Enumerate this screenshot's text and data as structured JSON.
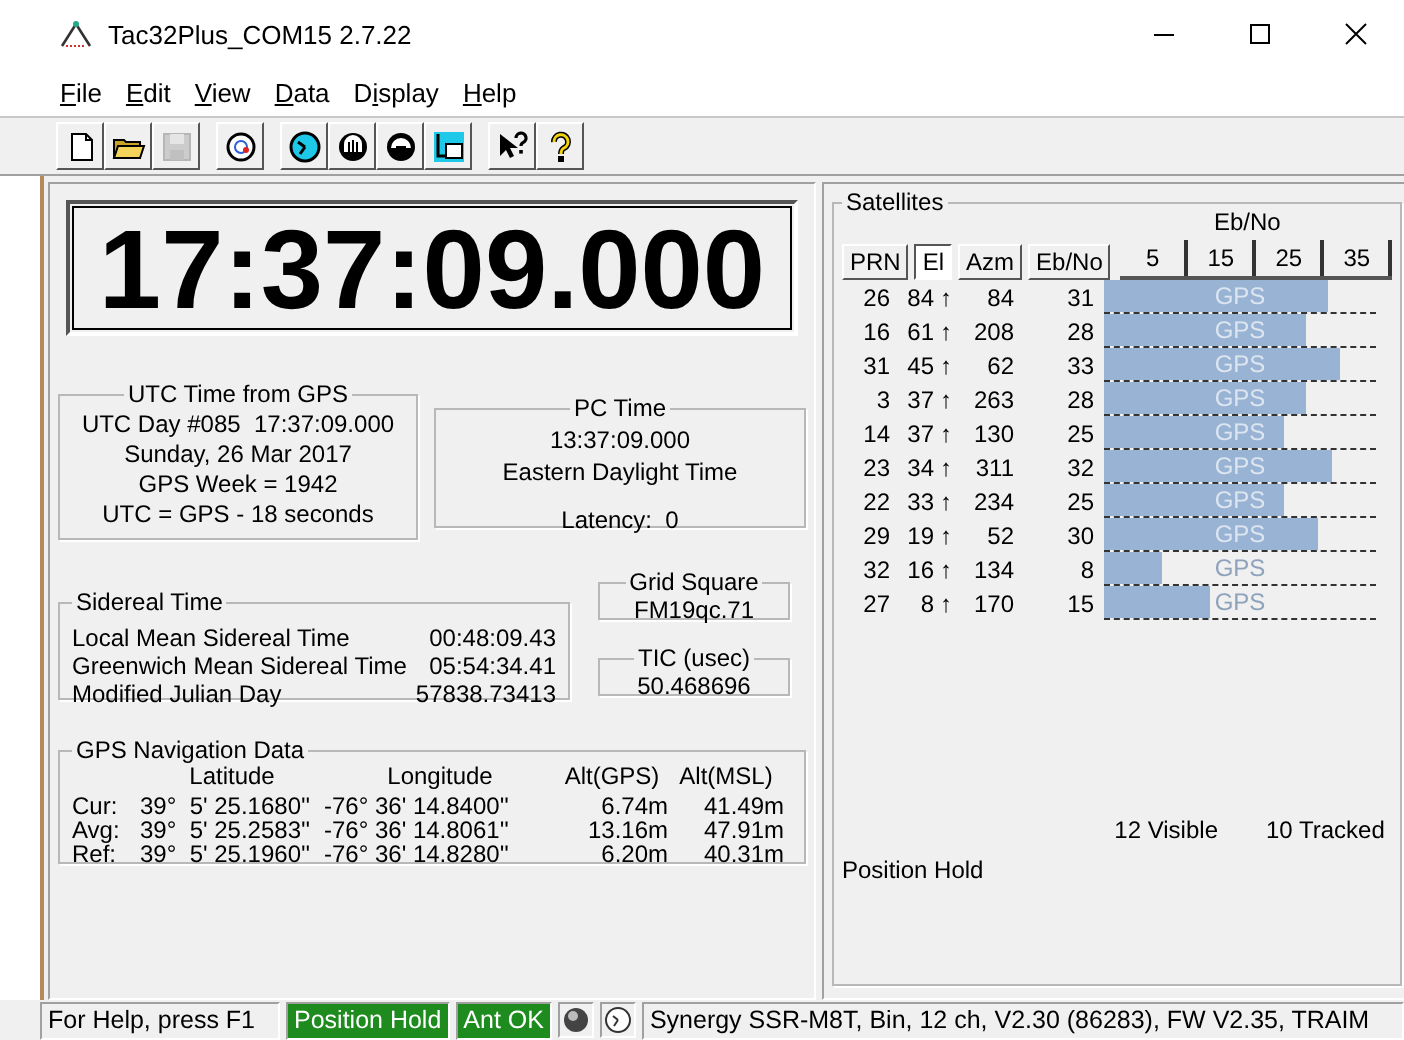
{
  "window": {
    "title": "Tac32Plus_COM15 2.7.22"
  },
  "menu": [
    {
      "key": "F",
      "after": "ile"
    },
    {
      "key": "E",
      "after": "dit"
    },
    {
      "key": "V",
      "after": "iew"
    },
    {
      "key": "D",
      "after": "ata"
    },
    {
      "before": "D",
      "key": "i",
      "after": "splay"
    },
    {
      "key": "H",
      "after": "elp"
    }
  ],
  "toolbar": [
    [
      {
        "disabled": false
      },
      {
        "disabled": false
      },
      {
        "disabled": true
      }
    ],
    [
      {
        "disabled": false
      }
    ],
    [
      {
        "disabled": false
      },
      {
        "disabled": false
      },
      {
        "disabled": false
      },
      {
        "disabled": false
      }
    ],
    [
      {
        "disabled": false
      },
      {
        "disabled": false
      }
    ]
  ],
  "clock": "17:37:09.000",
  "utc": {
    "title": "UTC Time from GPS",
    "lines": [
      "UTC Day #085  17:37:09.000",
      "Sunday, 26 Mar 2017",
      "GPS Week = 1942",
      "UTC = GPS - 18 seconds"
    ]
  },
  "pc_time": {
    "title": "PC Time",
    "lines": [
      "13:37:09.000",
      "Eastern Daylight Time"
    ],
    "latency": "Latency:  0"
  },
  "sidereal": {
    "title": "Sidereal Time",
    "rows": [
      {
        "label": "Local Mean Sidereal Time",
        "value": "00:48:09.43"
      },
      {
        "label": "Greenwich Mean Sidereal Time",
        "value": "05:54:34.41"
      },
      {
        "label": "Modified Julian Day",
        "value": "57838.73413"
      }
    ]
  },
  "grid_square": {
    "title": "Grid Square",
    "value": "FM19qc.71"
  },
  "tic": {
    "title": "TIC (usec)",
    "value": "50.468696"
  },
  "navigation": {
    "title": "GPS Navigation Data",
    "columns": [
      "Latitude",
      "Longitude",
      "Alt(GPS)",
      "Alt(MSL)"
    ],
    "rows": [
      {
        "label": "Cur:",
        "latitude": "39°  5' 25.1680''",
        "longitude": "-76° 36' 14.8400''",
        "alt_gps": "6.74m",
        "alt_msl": "41.49m"
      },
      {
        "label": "Avg:",
        "latitude": "39°  5' 25.2583''",
        "longitude": "-76° 36' 14.8061''",
        "alt_gps": "13.16m",
        "alt_msl": "47.91m"
      },
      {
        "label": "Ref:",
        "latitude": "39°  5' 25.1960''",
        "longitude": "-76° 36' 14.8280''",
        "alt_gps": "6.20m",
        "alt_msl": "40.31m"
      }
    ]
  },
  "satellites": {
    "title": "Satellites",
    "scale_title": "Eb/No",
    "columns": [
      {
        "label": "PRN",
        "selected": false
      },
      {
        "label": "El",
        "selected": true
      },
      {
        "label": "Azm",
        "selected": false
      },
      {
        "label": "Eb/No",
        "selected": false
      }
    ],
    "ticks": [
      "5",
      "15",
      "25",
      "35"
    ],
    "rows": [
      {
        "prn": "26",
        "el": "84",
        "arrow": "↑",
        "azm": "84",
        "ebno": "31",
        "level": 0.82,
        "label": "GPS"
      },
      {
        "prn": "16",
        "el": "61",
        "arrow": "↑",
        "azm": "208",
        "ebno": "28",
        "level": 0.74,
        "label": "GPS"
      },
      {
        "prn": "31",
        "el": "45",
        "arrow": "↑",
        "azm": "62",
        "ebno": "33",
        "level": 0.87,
        "label": "GPS"
      },
      {
        "prn": "3",
        "el": "37",
        "arrow": "↑",
        "azm": "263",
        "ebno": "28",
        "level": 0.74,
        "label": "GPS"
      },
      {
        "prn": "14",
        "el": "37",
        "arrow": "↑",
        "azm": "130",
        "ebno": "25",
        "level": 0.66,
        "label": "GPS"
      },
      {
        "prn": "23",
        "el": "34",
        "arrow": "↑",
        "azm": "311",
        "ebno": "32",
        "level": 0.84,
        "label": "GPS"
      },
      {
        "prn": "22",
        "el": "33",
        "arrow": "↑",
        "azm": "234",
        "ebno": "25",
        "level": 0.66,
        "label": "GPS"
      },
      {
        "prn": "29",
        "el": "19",
        "arrow": "↑",
        "azm": "52",
        "ebno": "30",
        "level": 0.79,
        "label": "GPS"
      },
      {
        "prn": "32",
        "el": "16",
        "arrow": "↑",
        "azm": "134",
        "ebno": "8",
        "level": 0.21,
        "label": "GPS"
      },
      {
        "prn": "27",
        "el": "8",
        "arrow": "↑",
        "azm": "170",
        "ebno": "15",
        "level": 0.39,
        "label": "GPS"
      }
    ],
    "visible": "12 Visible",
    "tracked": "10 Tracked",
    "mode": "Position Hold"
  },
  "status_bar": {
    "help": "For Help, press F1",
    "indicators": [
      {
        "label": "Position Hold",
        "color": "#1e8b1e"
      },
      {
        "label": "Ant OK",
        "color": "#1e8b1e"
      }
    ],
    "receiver": "Synergy SSR-M8T, Bin, 12 ch, V2.30 (86283), FW V2.35, TRAIM"
  }
}
